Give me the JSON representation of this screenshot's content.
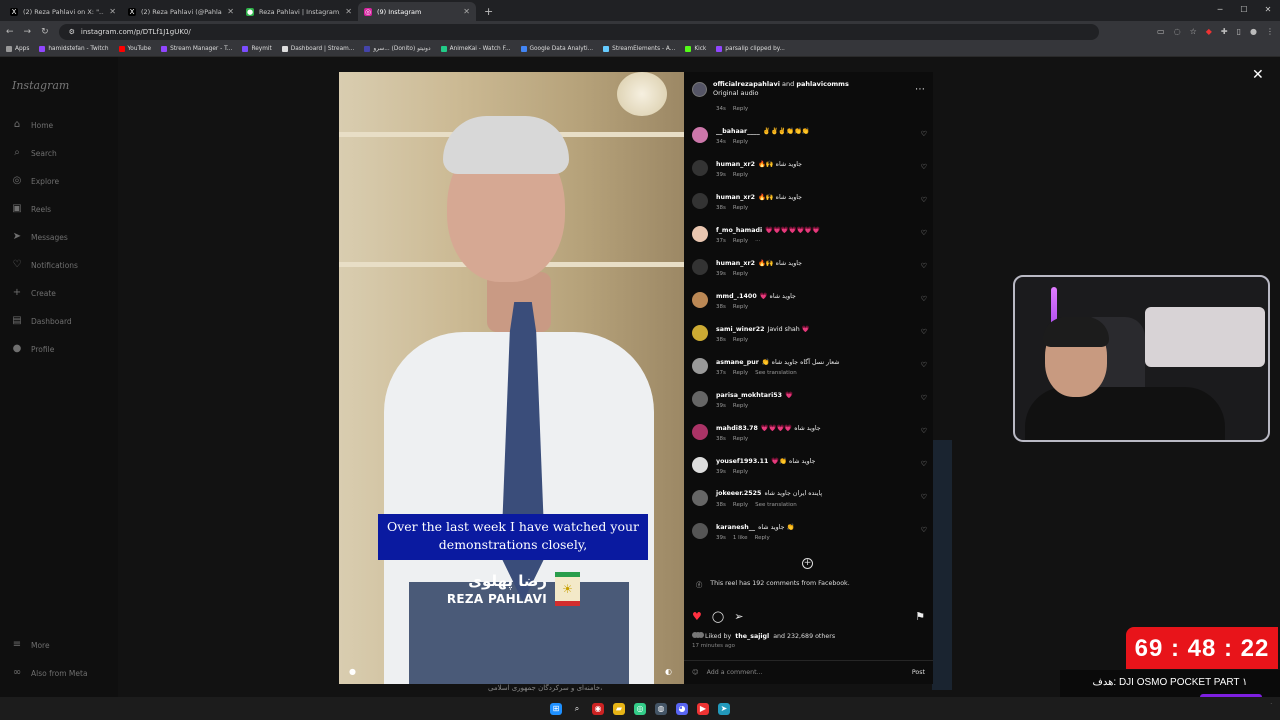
{
  "tabs": [
    {
      "title": "(2) Reza Pahlavi on X: \"...راهم کرد",
      "fav": "X",
      "color": "#000000",
      "active": false
    },
    {
      "title": "(2) Reza Pahlavi (@PahlaviReza)",
      "fav": "X",
      "color": "#000000",
      "active": false
    },
    {
      "title": "Reza Pahlavi | Instagram, Facebook",
      "fav": "●",
      "color": "#2fb34a",
      "active": false
    },
    {
      "title": "(9) Instagram",
      "fav": "◎",
      "color": "#d6249f",
      "active": true
    }
  ],
  "address": {
    "url": "instagram.com/p/DTLf1J1gUK0/"
  },
  "bookmarks": [
    "Apps",
    "hamidstefan - Twitch",
    "YouTube",
    "Stream Manager - T...",
    "Reymit",
    "Dashboard | Stream...",
    "سرو... (Donito) دونیتو",
    "AnimeKai - Watch F...",
    "Google Data Analyti...",
    "StreamElements - A...",
    "Kick",
    "parsalip clipped by..."
  ],
  "sidebar": {
    "logo": "Instagram",
    "items": [
      {
        "label": "Home",
        "icon": "home-icon",
        "glyph": "⌂"
      },
      {
        "label": "Search",
        "icon": "search-icon",
        "glyph": "⌕"
      },
      {
        "label": "Explore",
        "icon": "explore-icon",
        "glyph": "◎"
      },
      {
        "label": "Reels",
        "icon": "reels-icon",
        "glyph": "▣"
      },
      {
        "label": "Messages",
        "icon": "messages-icon",
        "glyph": "➤"
      },
      {
        "label": "Notifications",
        "icon": "heart-icon",
        "glyph": "♡"
      },
      {
        "label": "Create",
        "icon": "plus-icon",
        "glyph": "+"
      },
      {
        "label": "Dashboard",
        "icon": "dashboard-icon",
        "glyph": "▤"
      },
      {
        "label": "Profile",
        "icon": "profile-icon",
        "glyph": "●"
      }
    ],
    "more": "More",
    "meta": "Also from Meta"
  },
  "video": {
    "subtitle_line1": "Over the last week I have watched your",
    "subtitle_line2": "demonstrations closely,",
    "name_fa": "رضا پهلوی",
    "name_en": "REZA PAHLAVI"
  },
  "post": {
    "header_user1": "officialrezapahlavi",
    "header_and": "and",
    "header_user2": "pahlavicomms",
    "audio": "Original audio",
    "comments": [
      {
        "user": "",
        "text": "",
        "time": "34s",
        "extra": ""
      },
      {
        "user": "__bahaar____",
        "text": "✌️✌️✌️👏👏👏",
        "time": "34s",
        "extra": ""
      },
      {
        "user": "human_xr2",
        "text": "🔥🙌 جاوید شاه",
        "time": "39s",
        "extra": ""
      },
      {
        "user": "human_xr2",
        "text": "🔥🙌 جاوید شاه",
        "time": "38s",
        "extra": ""
      },
      {
        "user": "f_mo_hamadi",
        "text": "💗💗💗💗💗💗💗",
        "time": "37s",
        "extra": "···"
      },
      {
        "user": "human_xr2",
        "text": "🔥🙌 جاوید شاه",
        "time": "39s",
        "extra": ""
      },
      {
        "user": "mmd_.1400",
        "text": "💗 جاوید شاه",
        "time": "38s",
        "extra": ""
      },
      {
        "user": "sami_winer22",
        "text": "Javid shah 💗",
        "time": "38s",
        "extra": ""
      },
      {
        "user": "asmane_pur",
        "text": "👏 شعار نسل آگاه جاوید شاه",
        "time": "37s",
        "extra": "See translation"
      },
      {
        "user": "parisa_mokhtari53",
        "text": "💗",
        "time": "39s",
        "extra": ""
      },
      {
        "user": "mahdi83.78",
        "text": "💗💗💗💗 جاوید شاه",
        "time": "38s",
        "extra": ""
      },
      {
        "user": "yousef1993.11",
        "text": "💗👏 جاوید شاه",
        "time": "39s",
        "extra": ""
      },
      {
        "user": "jokeeer.2525",
        "text": "پاینده ایران جاوید شاه",
        "time": "38s",
        "extra": "See translation"
      },
      {
        "user": "karanesh__",
        "text": "جاوید شاه 👏",
        "time": "39s",
        "extra": "1 like"
      }
    ],
    "reply": "Reply",
    "fb_note": "This reel has 192 comments from Facebook.",
    "liked_by": "Liked by",
    "liked_user": "the_sajigl",
    "liked_rest": "and 232,689 others",
    "ago": "17 minutes ago",
    "add_comment": "Add a comment...",
    "post_btn": "Post"
  },
  "overlay": {
    "timer": "69 : 48 : 22",
    "goal": "هدف: DJI OSMO POCKET PART ١"
  },
  "background_text": "خامنه‌ای و سرکردگان جمهوری اسلامی،",
  "colors": {
    "like": "#ff3040",
    "timer_bg": "#e8141a",
    "subtitle_bg": "#0a1aa0",
    "goal_bar": "#7d1fe0"
  }
}
